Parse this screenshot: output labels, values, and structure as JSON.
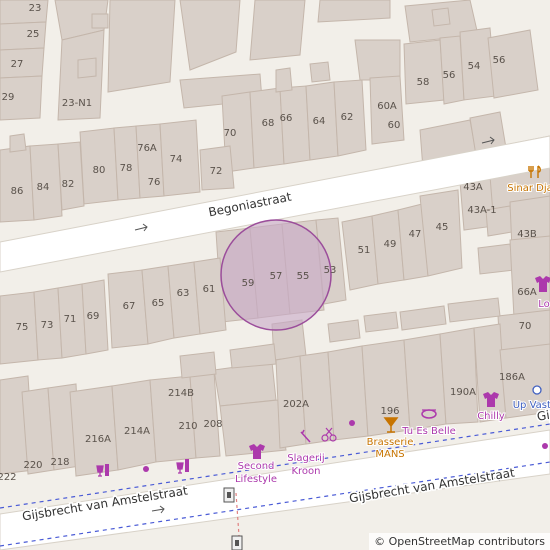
{
  "map": {
    "streets": [
      {
        "name": "Begoniastraat"
      },
      {
        "name": "Gijsbrecht van Amstelstraat"
      },
      {
        "name": "Gijsbrecht van Amstelstraat"
      },
      {
        "name": "Gij"
      }
    ],
    "house_numbers": [
      "23",
      "25",
      "27",
      "29",
      "23-N1",
      "58",
      "56",
      "54",
      "56",
      "60A",
      "60",
      "70",
      "68",
      "66",
      "64",
      "62",
      "80",
      "78",
      "76A",
      "74",
      "76",
      "72",
      "86",
      "84",
      "82",
      "51",
      "49",
      "47",
      "45",
      "43A",
      "43A-1",
      "43B",
      "59",
      "57",
      "55",
      "53",
      "67",
      "65",
      "63",
      "61",
      "75",
      "73",
      "71",
      "69",
      "66A",
      "70",
      "214B",
      "216A",
      "214A",
      "210",
      "208",
      "202A",
      "196",
      "190A",
      "186A",
      "220",
      "218",
      "222"
    ],
    "pois": [
      {
        "name": "Sinar Dja",
        "icon": "restaurant-icon",
        "color": "#c77400"
      },
      {
        "name": "Lo",
        "icon": "clothes-icon",
        "color": "#ac39ac"
      },
      {
        "name": "Tu Es Belle",
        "icon": "beauty-icon",
        "color": "#ac39ac"
      },
      {
        "name": "Brasserie MANS",
        "icon": "bar-icon",
        "color": "#c77400"
      },
      {
        "name": "Chilly",
        "icon": "clothes-icon",
        "color": "#ac39ac"
      },
      {
        "name": "Up Vastg",
        "icon": "shop-icon",
        "color": "#ac39ac"
      },
      {
        "name": "Slagerij Kroon",
        "icon": "butcher-icon",
        "color": "#ac39ac"
      },
      {
        "name": "Second Lifestyle",
        "icon": "clothes-icon",
        "color": "#ac39ac"
      },
      {
        "name": "",
        "icon": "shop-dot-icon",
        "color": "#ac39ac"
      },
      {
        "name": "",
        "icon": "alcohol-icon",
        "color": "#ac39ac"
      },
      {
        "name": "",
        "icon": "scissors-icon",
        "color": "#ac39ac"
      },
      {
        "name": "",
        "icon": "wine-icon",
        "color": "#ac39ac"
      },
      {
        "name": "",
        "icon": "tram-stop-icon",
        "color": "#555555"
      }
    ],
    "highlight": {
      "fill": "#c8a8c8",
      "stroke": "#9b4d9b",
      "opacity": 0.6
    },
    "attribution": "© OpenStreetMap contributors"
  },
  "colors": {
    "background": "#f2efe9",
    "building": "#d9d0c9",
    "road": "#ffffff",
    "tram": "#4a5bd6",
    "poi_shop": "#ac39ac",
    "poi_food": "#c77400"
  }
}
